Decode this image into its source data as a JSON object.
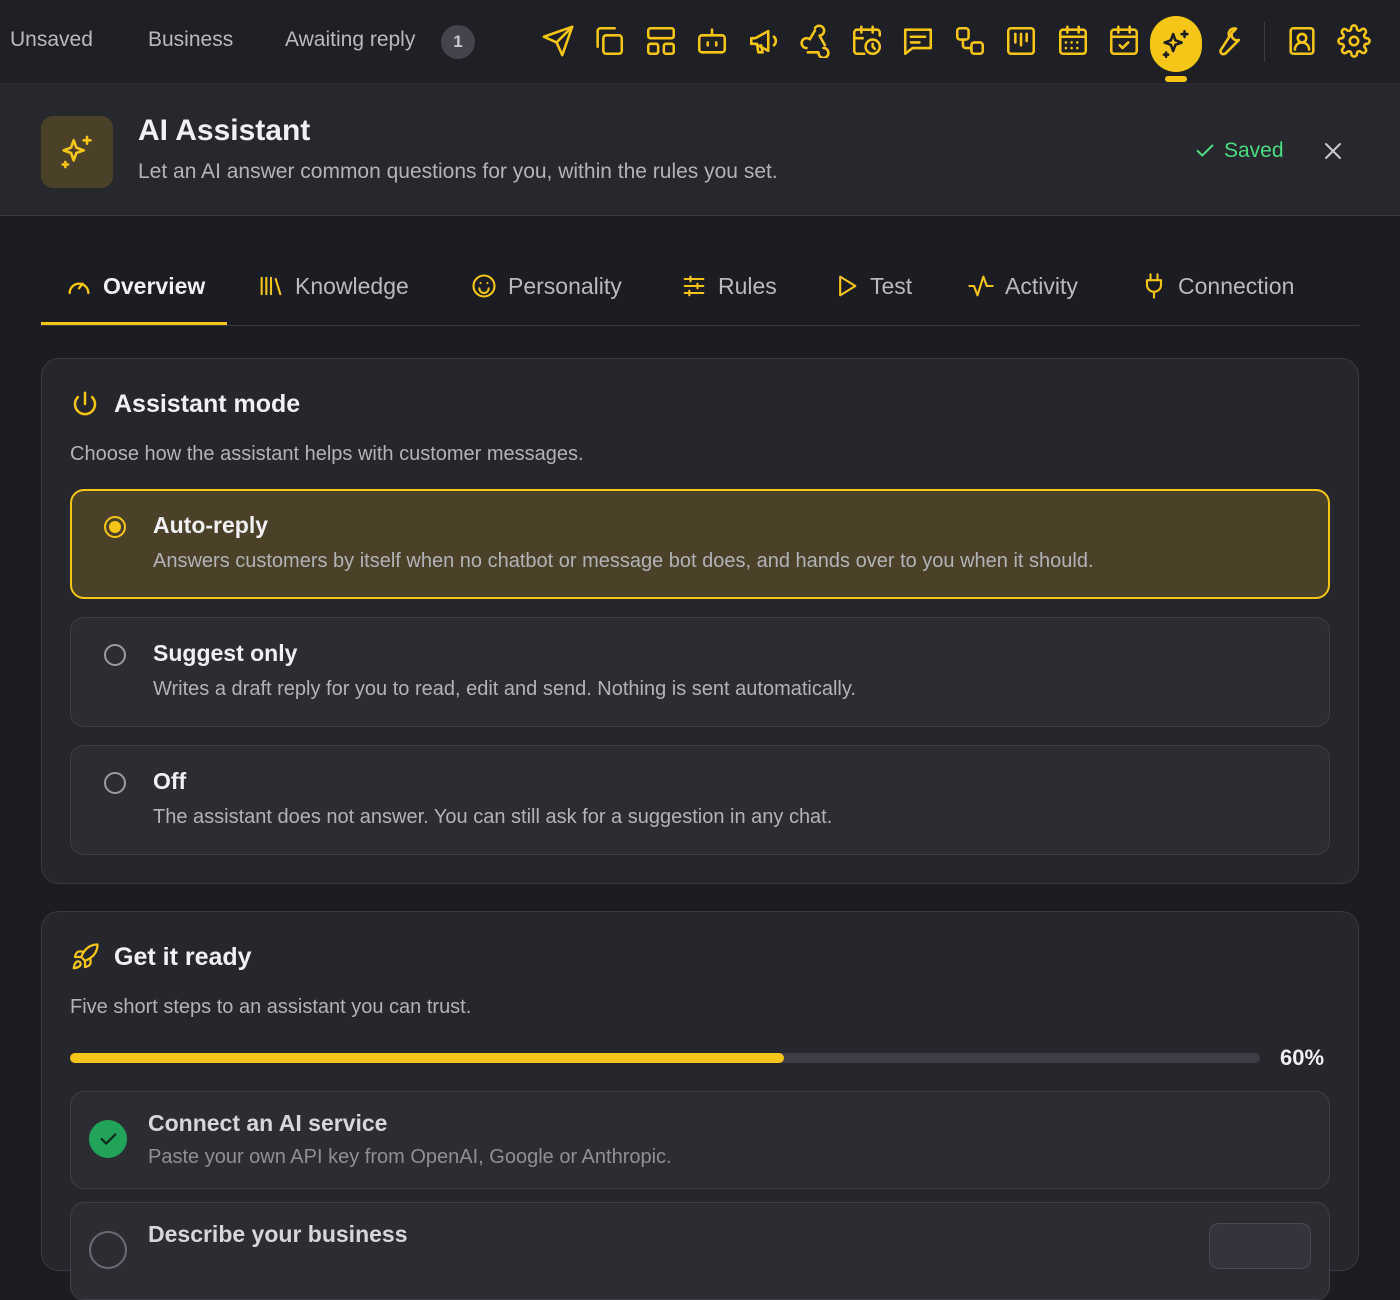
{
  "topbar": {
    "tabs": [
      "Unsaved",
      "Business",
      "Awaiting reply"
    ],
    "awaiting_count": "1",
    "icons": [
      "send-icon",
      "copy-icon",
      "layout-icon",
      "bot-icon",
      "megaphone-icon",
      "webhook-icon",
      "calendar-clock-icon",
      "message-icon",
      "workflow-icon",
      "kanban-icon",
      "calendar-grid-icon",
      "calendar-check-icon",
      "sparkles-icon",
      "wrench-icon",
      "contact-icon",
      "gear-icon"
    ],
    "active_icon": "sparkles-icon"
  },
  "header": {
    "title": "AI Assistant",
    "subtitle": "Let an AI answer common questions for you, within the rules you set.",
    "saved_label": "Saved"
  },
  "subtabs": [
    {
      "label": "Overview",
      "icon": "gauge-icon",
      "active": true
    },
    {
      "label": "Knowledge",
      "icon": "library-icon"
    },
    {
      "label": "Personality",
      "icon": "smile-icon"
    },
    {
      "label": "Rules",
      "icon": "sliders-icon"
    },
    {
      "label": "Test",
      "icon": "play-icon"
    },
    {
      "label": "Activity",
      "icon": "activity-icon"
    },
    {
      "label": "Connection",
      "icon": "plug-icon"
    }
  ],
  "mode": {
    "title": "Assistant mode",
    "description": "Choose how the assistant helps with customer messages.",
    "options": [
      {
        "title": "Auto-reply",
        "description": "Answers customers by itself when no chatbot or message bot does, and hands over to you when it should.",
        "selected": true
      },
      {
        "title": "Suggest only",
        "description": "Writes a draft reply for you to read, edit and send. Nothing is sent automatically.",
        "selected": false
      },
      {
        "title": "Off",
        "description": "The assistant does not answer. You can still ask for a suggestion in any chat.",
        "selected": false
      }
    ]
  },
  "ready": {
    "title": "Get it ready",
    "description": "Five short steps to an assistant you can trust.",
    "progress": 0.6,
    "progress_label": "60%",
    "steps": [
      {
        "title": "Connect an AI service",
        "description": "Paste your own API key from OpenAI, Google or Anthropic.",
        "done": true
      },
      {
        "title": "Describe your business",
        "description": "",
        "done": false
      }
    ]
  },
  "colors": {
    "accent": "#f5c518",
    "success": "#4ade80",
    "background": "#1c1d22",
    "card": "#26272d"
  }
}
